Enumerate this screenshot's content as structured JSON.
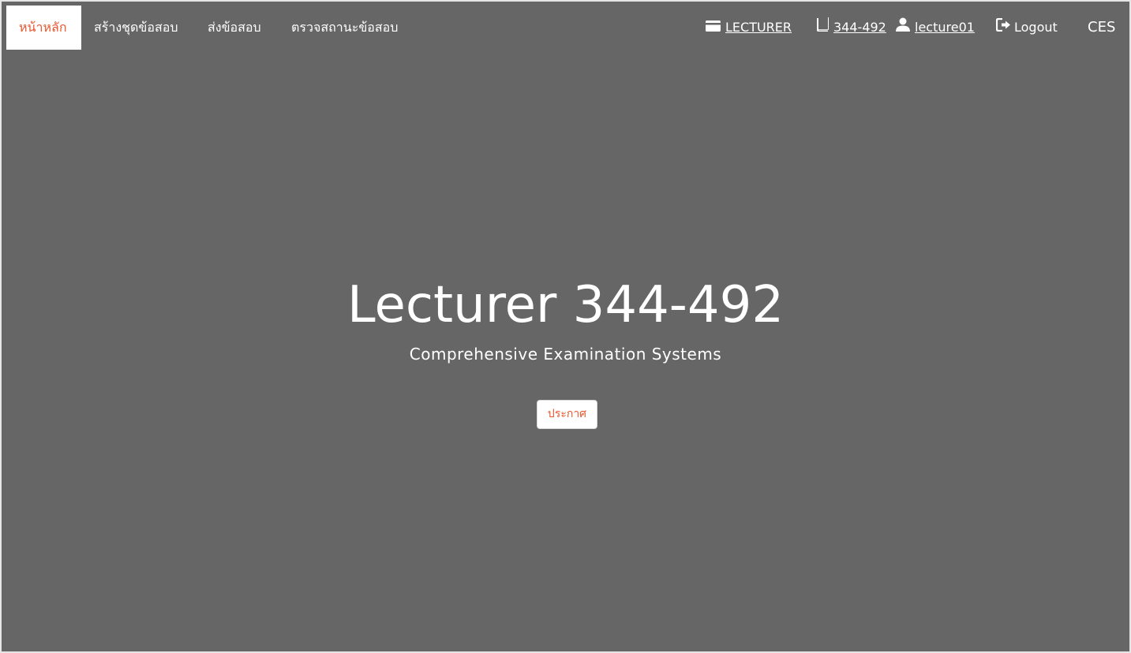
{
  "nav": {
    "items": [
      {
        "label": "หน้าหลัก",
        "active": true
      },
      {
        "label": "สร้างชุดข้อสอบ"
      },
      {
        "label": "ส่งข้อสอบ"
      },
      {
        "label": "ตรวจสถานะข้อสอบ"
      }
    ],
    "role": {
      "icon": "credit-card-icon",
      "label": "LECTURER"
    },
    "course": {
      "icon": "book-icon",
      "label": "344-492"
    },
    "user": {
      "icon": "user-icon",
      "label": "lecture01"
    },
    "logout": {
      "icon": "logout-icon",
      "label": "Logout"
    },
    "brand": "CES"
  },
  "hero": {
    "title": "Lecturer 344-492",
    "subtitle": "Comprehensive Examination Systems",
    "button_label": "ประกาศ"
  },
  "colors": {
    "background": "#666666",
    "accent": "#e8572f",
    "text": "#ffffff"
  }
}
